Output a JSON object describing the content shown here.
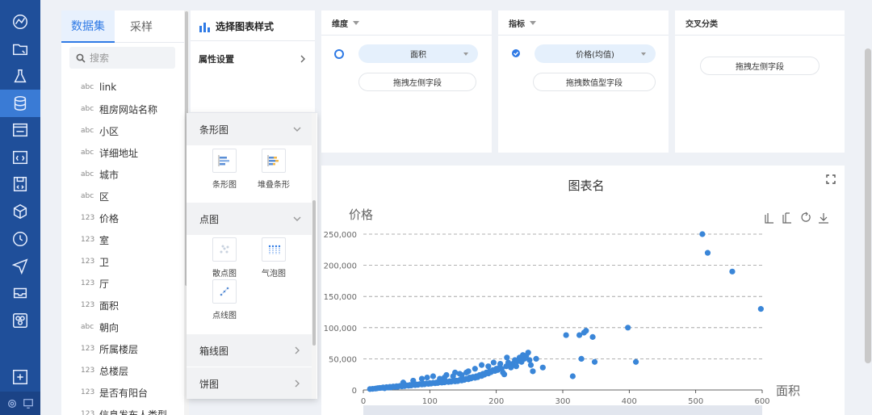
{
  "dataset": {
    "tabs": [
      "数据集",
      "采样"
    ],
    "search_placeholder": "搜索",
    "fields": [
      {
        "type": "abc",
        "name": "link"
      },
      {
        "type": "abc",
        "name": "租房网站名称"
      },
      {
        "type": "abc",
        "name": "小区"
      },
      {
        "type": "abc",
        "name": "详细地址"
      },
      {
        "type": "abc",
        "name": "城市"
      },
      {
        "type": "abc",
        "name": "区"
      },
      {
        "type": "123",
        "name": "价格"
      },
      {
        "type": "123",
        "name": "室"
      },
      {
        "type": "123",
        "name": "卫"
      },
      {
        "type": "123",
        "name": "厅"
      },
      {
        "type": "123",
        "name": "面积"
      },
      {
        "type": "abc",
        "name": "朝向"
      },
      {
        "type": "123",
        "name": "所属楼层"
      },
      {
        "type": "123",
        "name": "总楼层"
      },
      {
        "type": "123",
        "name": "是否有阳台"
      },
      {
        "type": "123",
        "name": "信息发布人类型"
      }
    ]
  },
  "chart_type_panel": {
    "title": "选择图表样式",
    "attr_label": "属性设置",
    "categories": [
      {
        "name": "条形图",
        "expanded": true,
        "items": [
          "条形图",
          "堆叠条形"
        ]
      },
      {
        "name": "点图",
        "expanded": true,
        "items": [
          "散点图",
          "气泡图",
          "点线图"
        ]
      },
      {
        "name": "箱线图",
        "expanded": false,
        "items": []
      },
      {
        "name": "饼图",
        "expanded": false,
        "items": []
      }
    ]
  },
  "dimension": {
    "title": "维度",
    "selected": "面积",
    "drop_hint": "拖拽左侧字段"
  },
  "metric": {
    "title": "指标",
    "selected": "价格(均值)",
    "drop_hint": "拖拽数值型字段"
  },
  "cross": {
    "title": "交叉分类",
    "drop_hint": "拖拽左侧字段"
  },
  "colors": {
    "nav": "#1f4f9a",
    "accent": "#2f7ae5",
    "point": "#3a86d8"
  },
  "chart_data": {
    "type": "scatter",
    "title": "图表名",
    "xlabel": "面积",
    "ylabel": "价格",
    "xlim": [
      0,
      600
    ],
    "ylim": [
      0,
      250000
    ],
    "x_ticks": [
      "0",
      "100",
      "200",
      "300",
      "400",
      "500",
      "600"
    ],
    "y_ticks": [
      "0",
      "50,000",
      "100,000",
      "150,000",
      "200,000",
      "250,000"
    ],
    "grid": "horizontal-dashed",
    "series": [
      {
        "points": [
          [
            10,
            1500
          ],
          [
            14,
            1800
          ],
          [
            18,
            2200
          ],
          [
            20,
            2500
          ],
          [
            22,
            3000
          ],
          [
            25,
            3200
          ],
          [
            28,
            3500
          ],
          [
            30,
            4000
          ],
          [
            32,
            2800
          ],
          [
            35,
            4500
          ],
          [
            38,
            3800
          ],
          [
            40,
            5000
          ],
          [
            42,
            4200
          ],
          [
            45,
            5500
          ],
          [
            48,
            4800
          ],
          [
            50,
            6000
          ],
          [
            52,
            5200
          ],
          [
            55,
            6500
          ],
          [
            58,
            5800
          ],
          [
            60,
            7000
          ],
          [
            62,
            6200
          ],
          [
            65,
            7500
          ],
          [
            68,
            6800
          ],
          [
            70,
            8000
          ],
          [
            72,
            7200
          ],
          [
            75,
            8500
          ],
          [
            78,
            7800
          ],
          [
            80,
            9000
          ],
          [
            82,
            8200
          ],
          [
            85,
            9500
          ],
          [
            88,
            8800
          ],
          [
            90,
            10000
          ],
          [
            92,
            9200
          ],
          [
            95,
            10500
          ],
          [
            98,
            9800
          ],
          [
            100,
            11000
          ],
          [
            102,
            10200
          ],
          [
            105,
            11500
          ],
          [
            108,
            10800
          ],
          [
            110,
            12000
          ],
          [
            112,
            11200
          ],
          [
            115,
            12500
          ],
          [
            118,
            11800
          ],
          [
            120,
            13000
          ],
          [
            122,
            12200
          ],
          [
            125,
            13500
          ],
          [
            128,
            12800
          ],
          [
            130,
            14000
          ],
          [
            132,
            13200
          ],
          [
            135,
            14500
          ],
          [
            138,
            13800
          ],
          [
            140,
            15000
          ],
          [
            142,
            14200
          ],
          [
            145,
            16000
          ],
          [
            148,
            15200
          ],
          [
            150,
            17000
          ],
          [
            152,
            16200
          ],
          [
            155,
            18000
          ],
          [
            158,
            17200
          ],
          [
            160,
            20000
          ],
          [
            162,
            18500
          ],
          [
            165,
            21000
          ],
          [
            168,
            19500
          ],
          [
            170,
            22000
          ],
          [
            172,
            20500
          ],
          [
            175,
            24000
          ],
          [
            178,
            22500
          ],
          [
            180,
            26000
          ],
          [
            182,
            24500
          ],
          [
            185,
            28000
          ],
          [
            188,
            26500
          ],
          [
            190,
            30000
          ],
          [
            192,
            28500
          ],
          [
            195,
            32000
          ],
          [
            198,
            30500
          ],
          [
            200,
            34000
          ],
          [
            202,
            32000
          ],
          [
            205,
            36000
          ],
          [
            208,
            34000
          ],
          [
            210,
            28000
          ],
          [
            212,
            25000
          ],
          [
            215,
            38000
          ],
          [
            218,
            44000
          ],
          [
            220,
            40000
          ],
          [
            222,
            36000
          ],
          [
            225,
            42000
          ],
          [
            228,
            48000
          ],
          [
            230,
            38000
          ],
          [
            232,
            46000
          ],
          [
            235,
            52000
          ],
          [
            238,
            45000
          ],
          [
            240,
            56000
          ],
          [
            242,
            50000
          ],
          [
            245,
            55000
          ],
          [
            248,
            60000
          ],
          [
            250,
            48000
          ],
          [
            252,
            40000
          ],
          [
            255,
            30000
          ],
          [
            260,
            50000
          ],
          [
            270,
            36000
          ],
          [
            122,
            20000
          ],
          [
            138,
            28000
          ],
          [
            148,
            24000
          ],
          [
            158,
            30000
          ],
          [
            168,
            34000
          ],
          [
            178,
            40000
          ],
          [
            188,
            38000
          ],
          [
            196,
            44000
          ],
          [
            206,
            42000
          ],
          [
            216,
            52000
          ],
          [
            60,
            12000
          ],
          [
            75,
            15000
          ],
          [
            88,
            18000
          ],
          [
            96,
            20000
          ],
          [
            105,
            22000
          ],
          [
            115,
            18000
          ],
          [
            125,
            24000
          ],
          [
            135,
            22000
          ],
          [
            145,
            26000
          ],
          [
            155,
            28000
          ],
          [
            305,
            88000
          ],
          [
            315,
            22000
          ],
          [
            325,
            88000
          ],
          [
            328,
            50000
          ],
          [
            332,
            92000
          ],
          [
            335,
            95000
          ],
          [
            345,
            85000
          ],
          [
            348,
            45000
          ],
          [
            398,
            100000
          ],
          [
            410,
            45000
          ],
          [
            510,
            250000
          ],
          [
            518,
            220000
          ],
          [
            555,
            190000
          ],
          [
            598,
            130000
          ]
        ]
      }
    ]
  }
}
